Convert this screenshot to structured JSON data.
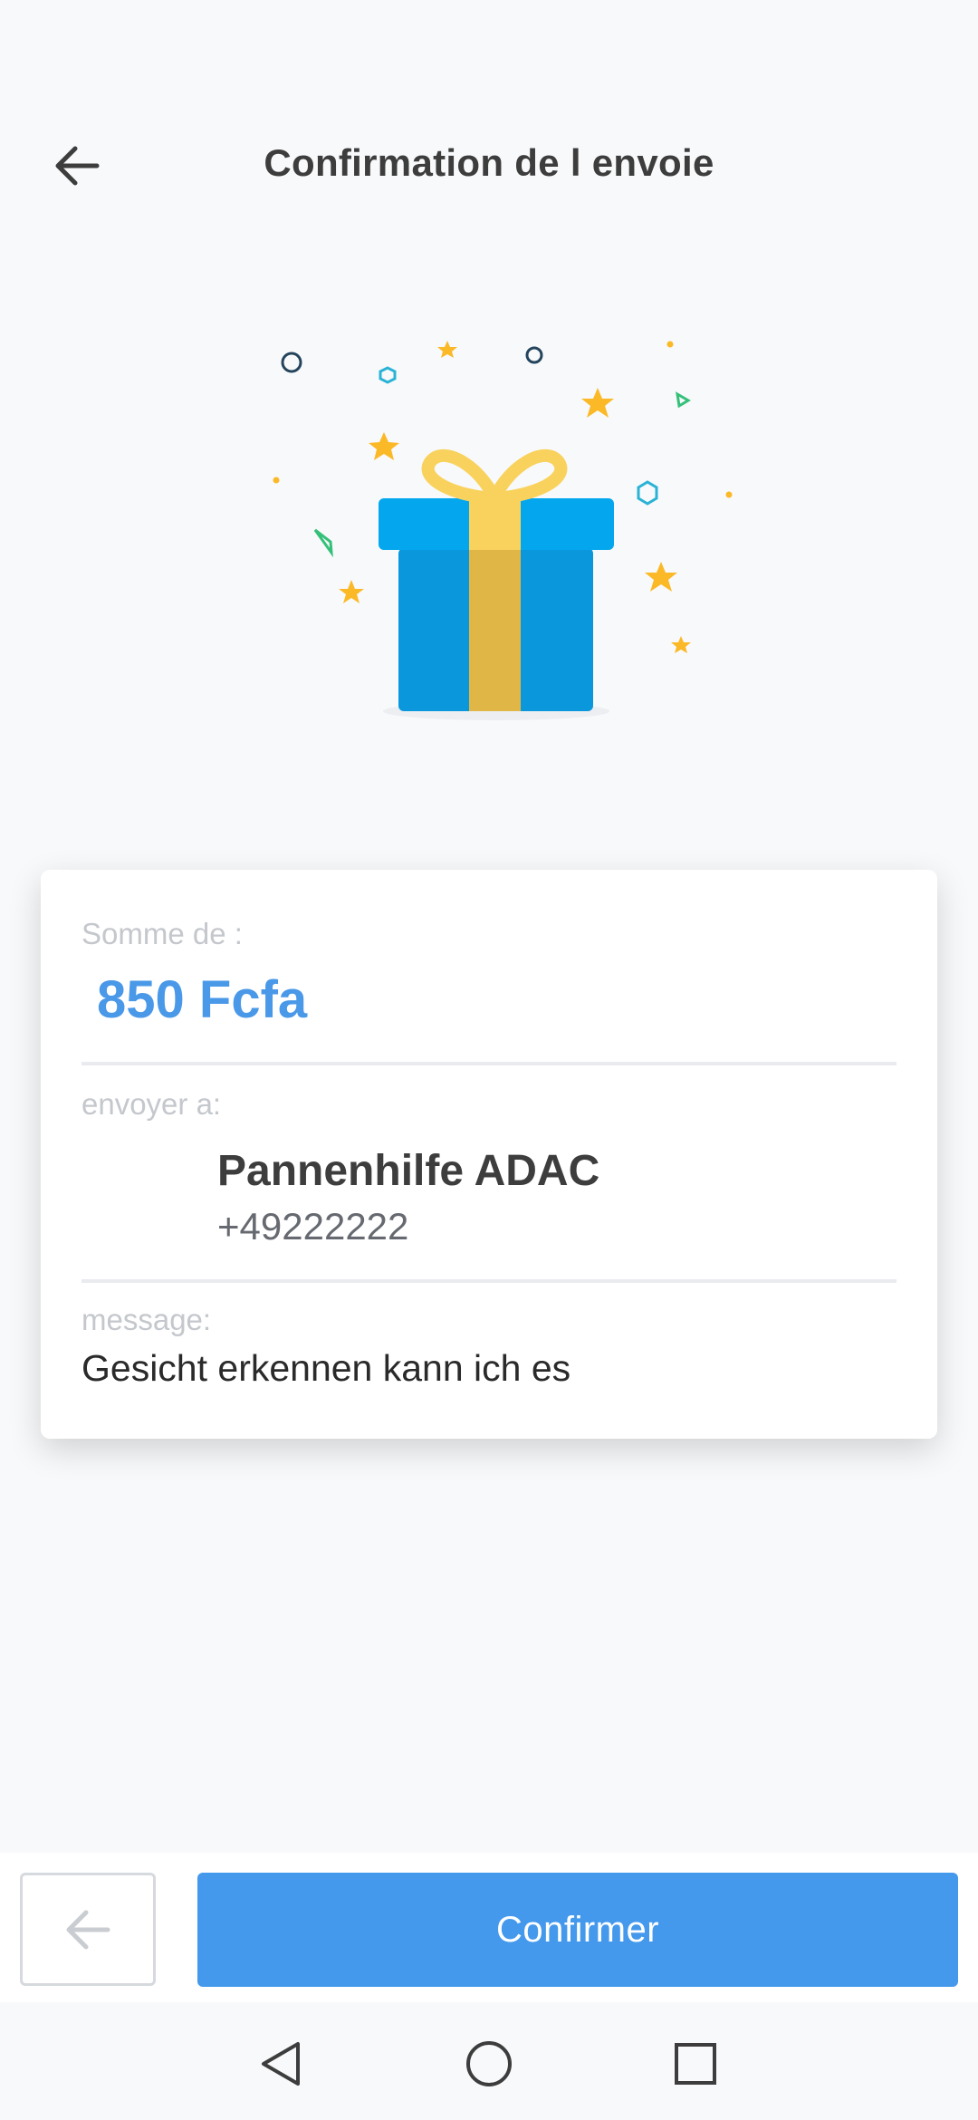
{
  "status_bar": {
    "left_text": "",
    "right_text": ""
  },
  "header": {
    "title": "Confirmation de l envoie",
    "back_icon": "arrow-left-icon"
  },
  "card": {
    "amount_label": "Somme de :",
    "amount_value": "850 Fcfa",
    "recipient_label": "envoyer a:",
    "recipient_name": "Pannenhilfe ADAC",
    "recipient_phone": "+49222222",
    "message_label": "message:",
    "message_text": "Gesicht erkennen kann ich es"
  },
  "actions": {
    "confirm_label": "Confirmer",
    "prev_icon": "arrow-left-icon"
  },
  "colors": {
    "accent": "#4499ec",
    "amount": "#4a98e8",
    "gift_blue": "#0a97dc",
    "gift_ribbon": "#f8cd56"
  },
  "nav": {
    "back_icon": "triangle-back-icon",
    "home_icon": "circle-home-icon",
    "recents_icon": "square-recents-icon"
  }
}
